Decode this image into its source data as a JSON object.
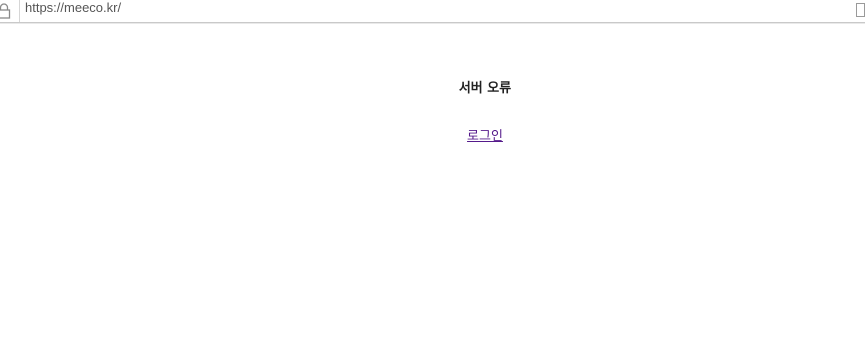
{
  "browser": {
    "url": "https://meeco.kr/",
    "lock_icon": "lock-icon",
    "page_icon": "page-icon"
  },
  "main": {
    "error_title": "서버 오류",
    "login_link": "로그인"
  },
  "colors": {
    "link_visited": "#551a8b",
    "url_text": "#555555"
  }
}
